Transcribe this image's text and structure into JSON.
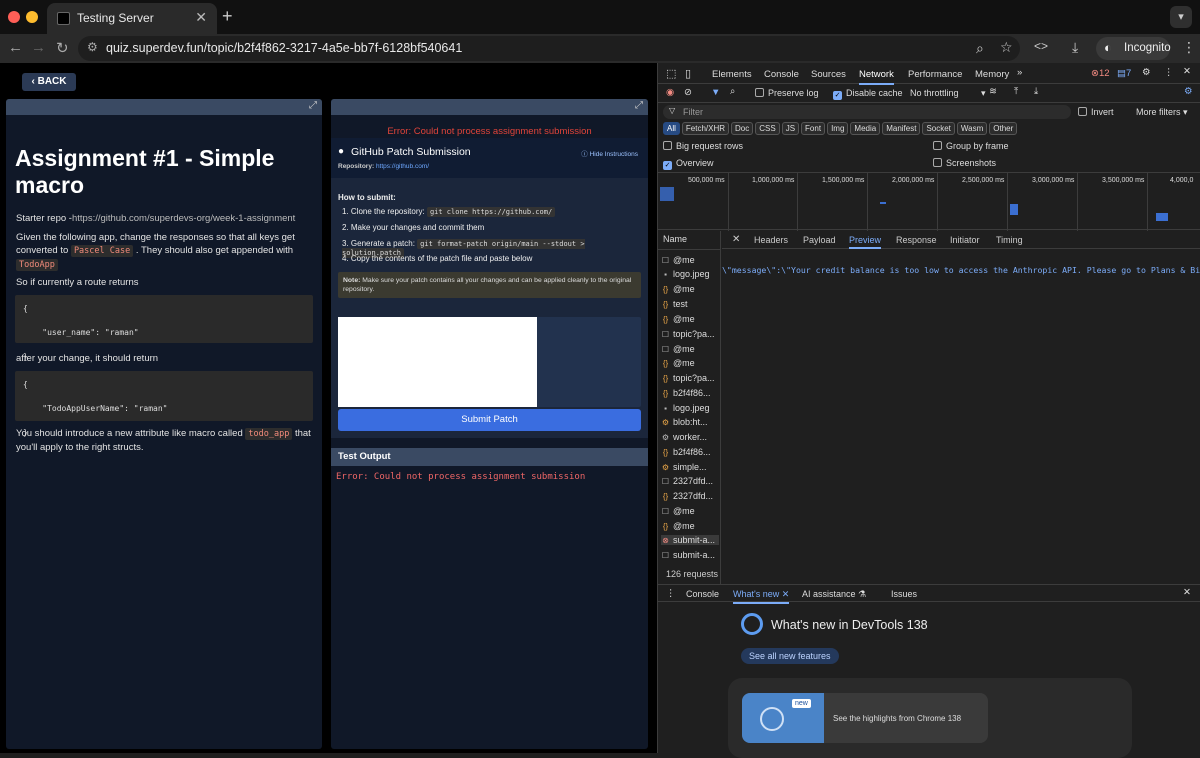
{
  "browser": {
    "tab_title": "Testing Server",
    "url": "quiz.superdev.fun/topic/b2f4f862-3217-4a5e-bb7f-6128bf540641",
    "incognito_label": "Incognito"
  },
  "page": {
    "back_label": "BACK",
    "title": "Assignment #1 - Simple macro",
    "starter_label": "Starter repo -",
    "starter_link": "https://github.com/superdevs-org/week-1-assignment",
    "intro_1": "Given the following app, change the responses so that all keys get converted to",
    "intro_code_1": "Pascel Case",
    "intro_2": ". They should also get appended with",
    "intro_code_2": "TodoApp",
    "currently": "So if currently a route returns",
    "code_before": "{\n\n    \"user_name\": \"raman\"\n\n}",
    "after_change": "after your change, it should return",
    "code_after": "{\n\n    \"TodoAppUserName\": \"raman\"\n\n}",
    "outro_1": "You should introduce a new attribute like macro called",
    "outro_code": "todo_app",
    "outro_2": "that you'll apply to the right structs.",
    "error_top": "Error: Could not process assignment submission",
    "gh_title": "GitHub Patch Submission",
    "repo_label": "Repository:",
    "repo_link": "https://github.com/",
    "hide_instructions": "Hide Instructions",
    "how_to": "How to submit:",
    "step1": "1. Clone the repository:",
    "step1_code": "git clone https://github.com/",
    "step2": "2. Make your changes and commit them",
    "step3": "3. Generate a patch:",
    "step3_code": "git format-patch origin/main --stdout > solution.patch",
    "step4": "4. Copy the contents of the patch file and paste below",
    "note_label": "Note:",
    "note_text": "Make sure your patch contains all your changes and can be applied cleanly to the original repository.",
    "submit_label": "Submit Patch",
    "test_output_label": "Test Output",
    "test_output_error": "Error: Could not process assignment submission"
  },
  "devtools": {
    "tabs": [
      "Elements",
      "Console",
      "Sources",
      "Network",
      "Performance",
      "Memory"
    ],
    "errors_count": "12",
    "messages_count": "7",
    "preserve_log": "Preserve log",
    "disable_cache": "Disable cache",
    "throttling": "No throttling",
    "filter_placeholder": "Filter",
    "invert": "Invert",
    "more_filters": "More filters",
    "type_filters": [
      "All",
      "Fetch/XHR",
      "Doc",
      "CSS",
      "JS",
      "Font",
      "Img",
      "Media",
      "Manifest",
      "Socket",
      "Wasm",
      "Other"
    ],
    "big_request_rows": "Big request rows",
    "group_by_frame": "Group by frame",
    "overview": "Overview",
    "screenshots": "Screenshots",
    "timeline_ticks": [
      "500,000 ms",
      "1,000,000 ms",
      "1,500,000 ms",
      "2,000,000 ms",
      "2,500,000 ms",
      "3,000,000 ms",
      "3,500,000 ms",
      "4,000,0"
    ],
    "name_header": "Name",
    "detail_tabs": [
      "Headers",
      "Payload",
      "Preview",
      "Response",
      "Initiator",
      "Timing"
    ],
    "preview_text": "\\\"message\\\":\\\"Your credit balance is too low to access the Anthropic API. Please go to Plans & Billing",
    "requests": [
      "@me",
      "logo.jpeg",
      "@me",
      "test",
      "@me",
      "topic?pa...",
      "@me",
      "@me",
      "topic?pa...",
      "b2f4f86...",
      "logo.jpeg",
      "blob:ht...",
      "worker...",
      "b2f4f86...",
      "simple...",
      "2327dfd...",
      "2327dfd...",
      "@me",
      "@me",
      "submit-a...",
      "submit-a..."
    ],
    "request_count": "126 requests",
    "drawer_tabs": [
      "Console",
      "What's new",
      "AI assistance",
      "Issues"
    ],
    "whats_new_title": "What's new in DevTools 138",
    "see_all": "See all new features",
    "highlights": "See the highlights from Chrome 138",
    "new_badge": "new"
  }
}
